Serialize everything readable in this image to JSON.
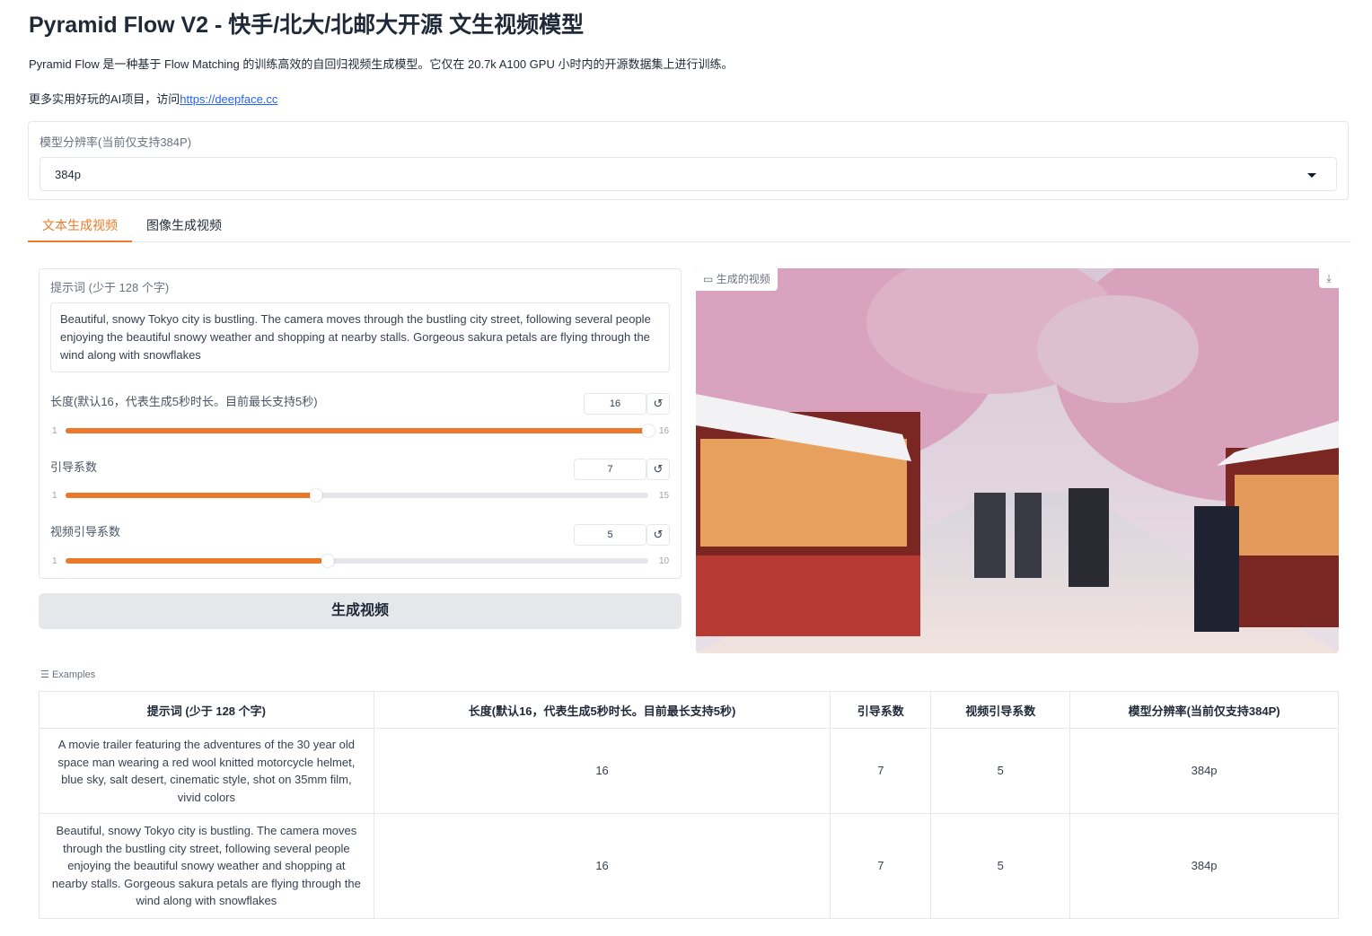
{
  "header": {
    "title": "Pyramid Flow V2 - 快手/北大/北邮大开源 文生视频模型",
    "description": "Pyramid Flow 是一种基于 Flow Matching 的训练高效的自回归视频生成模型。它仅在 20.7k A100 GPU 小时内的开源数据集上进行训练。",
    "more_prefix": "更多实用好玩的AI项目，访问",
    "more_link": "https://deepface.cc"
  },
  "resolution": {
    "label": "模型分辨率(当前仅支持384P)",
    "value": "384p"
  },
  "tabs": [
    {
      "label": "文本生成视频",
      "active": true
    },
    {
      "label": "图像生成视频",
      "active": false
    }
  ],
  "form": {
    "prompt_label": "提示词 (少于 128 个字)",
    "prompt_value": "Beautiful, snowy Tokyo city is bustling. The camera moves through the bustling city street, following several people enjoying the beautiful snowy weather and shopping at nearby stalls. Gorgeous sakura petals are flying through the wind along with snowflakes",
    "sliders": [
      {
        "label": "长度(默认16，代表生成5秒时长。目前最长支持5秒)",
        "value": "16",
        "min": "1",
        "max": "16",
        "reset": "↺"
      },
      {
        "label": "引导系数",
        "value": "7",
        "min": "1",
        "max": "15",
        "reset": "↺"
      },
      {
        "label": "视频引导系数",
        "value": "5",
        "min": "1",
        "max": "10",
        "reset": "↺"
      }
    ],
    "generate_button": "生成视频"
  },
  "video": {
    "label": "生成的视频",
    "icon": "video-camera-icon",
    "download_icon": "download-icon"
  },
  "examples": {
    "label": "Examples",
    "headers": [
      "提示词 (少于 128 个字)",
      "长度(默认16，代表生成5秒时长。目前最长支持5秒)",
      "引导系数",
      "视频引导系数",
      "模型分辨率(当前仅支持384P)"
    ],
    "rows": [
      [
        "A movie trailer featuring the adventures of the 30 year old space man wearing a red wool knitted motorcycle helmet, blue sky, salt desert, cinematic style, shot on 35mm film, vivid colors",
        "16",
        "7",
        "5",
        "384p"
      ],
      [
        "Beautiful, snowy Tokyo city is bustling. The camera moves through the bustling city street, following several people enjoying the beautiful snowy weather and shopping at nearby stalls. Gorgeous sakura petals are flying through the wind along with snowflakes",
        "16",
        "7",
        "5",
        "384p"
      ]
    ]
  },
  "colors": {
    "accent": "#ea7a2b",
    "link": "#2563eb",
    "border": "#e5e7eb"
  }
}
